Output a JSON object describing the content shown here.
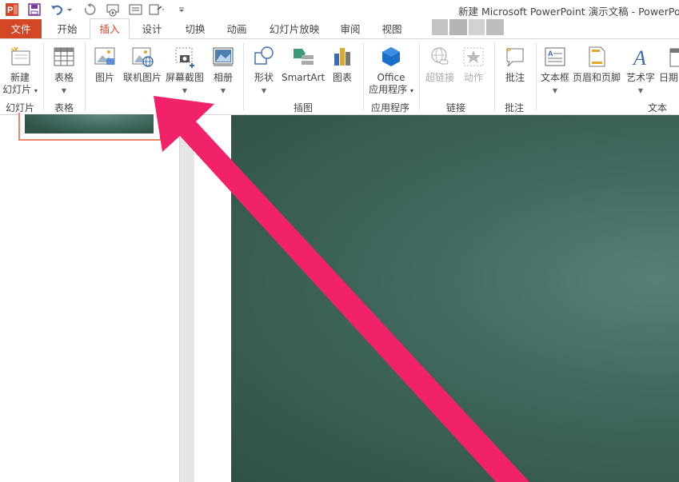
{
  "window": {
    "title": "新建 Microsoft PowerPoint 演示文稿 - PowerPoint"
  },
  "quick_access": {
    "icons": [
      "powerpoint-logo-icon",
      "save-icon",
      "undo-icon",
      "redo-icon",
      "slideshow-from-start-icon",
      "edit-icon",
      "touch-mode-icon",
      "customize-qat-icon"
    ]
  },
  "tabs": [
    {
      "label": "文件"
    },
    {
      "label": "开始"
    },
    {
      "label": "插入"
    },
    {
      "label": "设计"
    },
    {
      "label": "切换"
    },
    {
      "label": "动画"
    },
    {
      "label": "幻灯片放映"
    },
    {
      "label": "审阅"
    },
    {
      "label": "视图"
    }
  ],
  "active_tab": "插入",
  "ribbon": {
    "new_slide": {
      "line1": "新建",
      "line2": "幻灯片"
    },
    "table": {
      "label": "表格"
    },
    "picture": {
      "label": "图片"
    },
    "online_picture": {
      "label": "联机图片"
    },
    "screenshot": {
      "label": "屏幕截图"
    },
    "album": {
      "label": "相册"
    },
    "shapes": {
      "label": "形状"
    },
    "smartart": {
      "label": "SmartArt"
    },
    "chart": {
      "label": "图表"
    },
    "office_apps": {
      "line1": "Office",
      "line2": "应用程序"
    },
    "hyperlink": {
      "label": "超链接"
    },
    "action": {
      "label": "动作"
    },
    "comment": {
      "label": "批注"
    },
    "textbox": {
      "label": "文本框"
    },
    "header_footer": {
      "label": "页眉和页脚"
    },
    "wordart": {
      "label": "艺术字"
    },
    "datetime": {
      "label": "日期"
    },
    "groups": {
      "slides": "幻灯片",
      "tables": "表格",
      "images": "插图",
      "apps": "应用程序",
      "links": "链接",
      "comments": "批注",
      "text": "文本"
    }
  },
  "colors": {
    "accent": "#d24726",
    "annotation_arrow": "#f2226a",
    "slide_background": "#3d6258"
  }
}
